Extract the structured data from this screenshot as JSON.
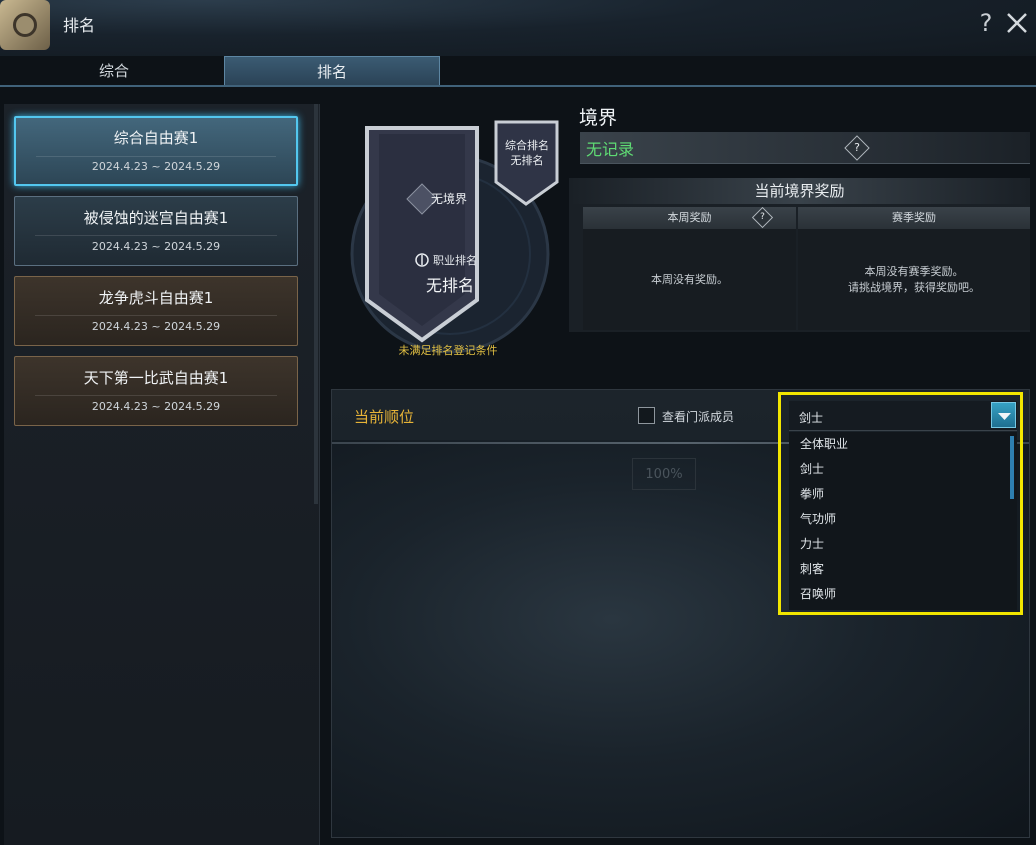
{
  "window": {
    "title": "排名"
  },
  "tabs": [
    {
      "label": "综合"
    },
    {
      "label": "排名"
    }
  ],
  "sidebar": {
    "events": [
      {
        "name": "综合自由赛1",
        "date": "2024.4.23 ~ 2024.5.29",
        "active": true
      },
      {
        "name": "被侵蚀的迷宫自由赛1",
        "date": "2024.4.23 ~ 2024.5.29"
      },
      {
        "name": "龙争虎斗自由赛1",
        "date": "2024.4.23 ~ 2024.5.29"
      },
      {
        "name": "天下第一比武自由赛1",
        "date": "2024.4.23 ~ 2024.5.29"
      }
    ]
  },
  "banner": {
    "realm": "无境界",
    "class_rank_label": "职业排名",
    "class_rank_value": "无排名",
    "overall_rank_label": "综合排名",
    "overall_rank_value": "无排名",
    "notice": "未满足排名登记条件"
  },
  "realm": {
    "title": "境界",
    "record": "无记录",
    "help": "?",
    "reward_title": "当前境界奖励",
    "weekly_reward_label": "本周奖励",
    "weekly_help": "?",
    "season_reward_label": "赛季奖励",
    "weekly_reward_text": "本周没有奖励。",
    "season_reward_line1": "本周没有赛季奖励。",
    "season_reward_line2": "请挑战境界，获得奖励吧。"
  },
  "ranking": {
    "title": "当前顺位",
    "guild_checkbox_label": "查看门派成员",
    "percent": "100%",
    "class_select": {
      "selected": "剑士",
      "options": [
        "全体职业",
        "剑士",
        "拳师",
        "气功师",
        "力士",
        "刺客",
        "召唤师"
      ]
    }
  },
  "colors": {
    "accent_blue": "#53c7ef",
    "title_gold": "#e6b337",
    "record_green": "#5fdc74",
    "highlight_yellow": "#f2e600"
  }
}
